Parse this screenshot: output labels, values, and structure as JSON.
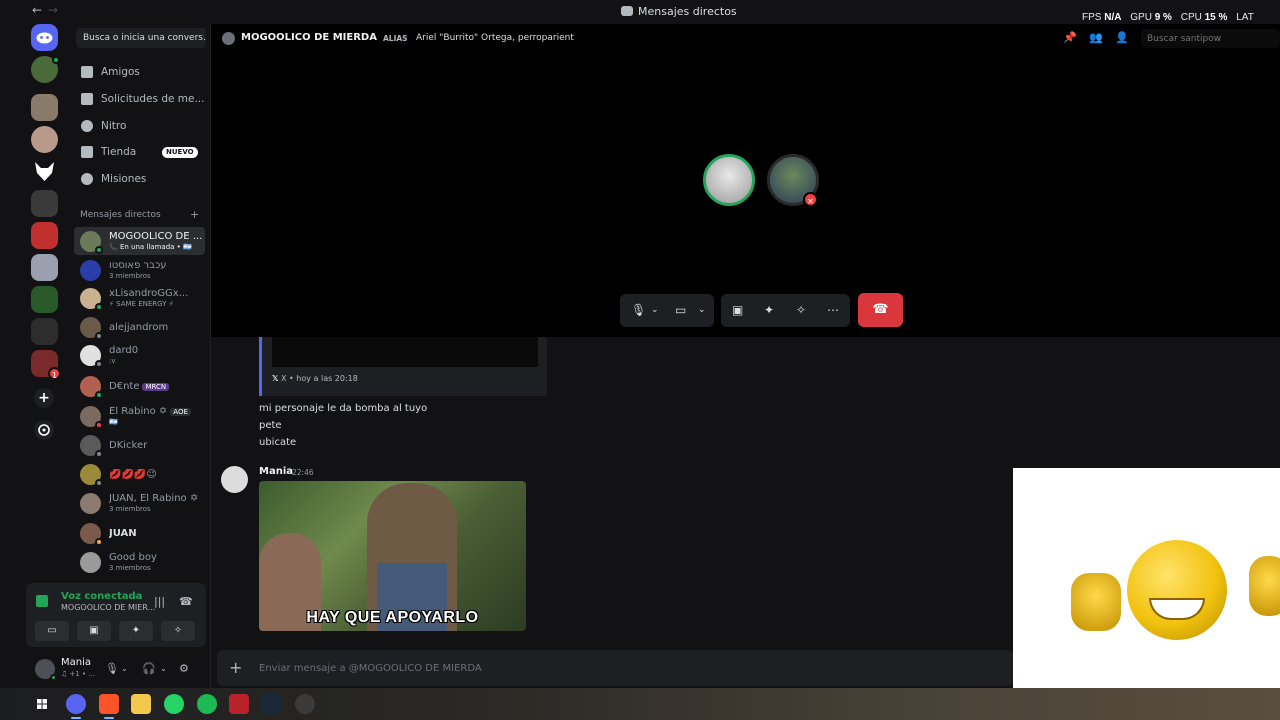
{
  "titlebar": {
    "back": "←",
    "forward": "→",
    "title": "Mensajes directos"
  },
  "overlay_stats": {
    "fps_label": "FPS",
    "fps_value": "N/A",
    "gpu_label": "GPU",
    "gpu_value": "9 %",
    "cpu_label": "CPU",
    "cpu_value": "15 %",
    "lat_label": "LAT"
  },
  "rail": {
    "add_server": "+",
    "badge_count": "1"
  },
  "sidebar": {
    "search_placeholder": "Busca o inicia una convers...",
    "nav": [
      {
        "label": "Amigos"
      },
      {
        "label": "Solicitudes de me..."
      },
      {
        "label": "Nitro"
      },
      {
        "label": "Tienda",
        "badge": "NUEVO"
      },
      {
        "label": "Misiones"
      }
    ],
    "dm_header": "Mensajes directos",
    "dm_add": "+",
    "dms": [
      {
        "name": "MOGOOLICO DE ...",
        "sub": "📞 En una llamada • 🇦🇷",
        "active": true
      },
      {
        "name": "עכבר פאוסטו",
        "sub": "3 miembros"
      },
      {
        "name": "xLisandroGGx...",
        "sub": "⚡ SAME ENERGY ⚡"
      },
      {
        "name": "alejjandrom",
        "sub": ""
      },
      {
        "name": "dard0",
        "sub": ":v"
      },
      {
        "name": "D€nte",
        "tag": "MRCN",
        "sub": ""
      },
      {
        "name": "El Rabino ✡",
        "tag": "AOE",
        "sub": "🇦🇷"
      },
      {
        "name": "DKicker",
        "sub": ""
      },
      {
        "name": "💋💋💋😉",
        "sub": ""
      },
      {
        "name": "JUAN, El Rabino ✡",
        "sub": "3 miembros"
      },
      {
        "name": "JUAN",
        "sub": ""
      },
      {
        "name": "Good boy",
        "sub": "3 miembros"
      }
    ]
  },
  "voice": {
    "status": "Voz conectada",
    "channel": "MOGOOLICO DE MIER..."
  },
  "user": {
    "name": "Mania",
    "sub": "♫ +1 • ..."
  },
  "header": {
    "name": "MOGOOLICO DE MIERDA",
    "alias_label": "ALIAS",
    "alias_value": "Ariel \"Burrito\" Ortega, perroparient",
    "search_placeholder": "Buscar santipow"
  },
  "messages": {
    "embed_footer": "X • hoy a las 20:18",
    "lines": [
      "mi personaje le da bomba al tuyo",
      "pete",
      "ubicate"
    ],
    "author": "Mania",
    "time": "22:46",
    "gif_caption": "HAY QUE APOYARLO"
  },
  "composer": {
    "placeholder": "Enviar mensaje a @MOGOOLICO DE MIERDA",
    "plus": "+"
  },
  "colors": {
    "brand": "#5865f2",
    "online": "#23a55a",
    "danger": "#da373c"
  }
}
